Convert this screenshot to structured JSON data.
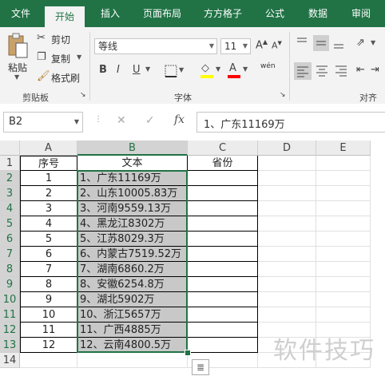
{
  "tabs": [
    "文件",
    "开始",
    "插入",
    "页面布局",
    "方方格子",
    "公式",
    "数据",
    "审阅"
  ],
  "active_tab": "开始",
  "clipboard": {
    "paste": "粘贴",
    "cut": "剪切",
    "copy": "复制",
    "format_painter": "格式刷",
    "group_label": "剪贴板"
  },
  "font": {
    "name": "等线",
    "size": "11",
    "bold": "B",
    "italic": "I",
    "underline": "U",
    "wen": "wén",
    "group_label": "字体"
  },
  "alignment": {
    "group_label": "对齐方"
  },
  "icons": {
    "cut": "scissors-icon",
    "copy": "copy-icon",
    "painter": "format-painter-icon",
    "grow": "increase-font-icon",
    "shrink": "decrease-font-icon",
    "border": "border-icon",
    "fill": "fill-color-icon",
    "fontcolor": "font-color-icon",
    "cancel": "cancel-icon",
    "enter": "check-icon",
    "fx": "function-icon"
  },
  "colors": {
    "accent": "#217346",
    "fill_yellow": "#ffff00",
    "font_red": "#ff0000"
  },
  "formula_bar": {
    "name_box": "B2",
    "fx": "fx",
    "content": "1、广东11169万"
  },
  "columns": [
    "A",
    "B",
    "C",
    "D",
    "E"
  ],
  "headers": {
    "a": "序号",
    "b": "文本",
    "c": "省份"
  },
  "rows": [
    {
      "num": "1",
      "a": "1",
      "b": "1、广东11169万"
    },
    {
      "num": "2",
      "a": "2",
      "b": "2、山东10005.83万"
    },
    {
      "num": "3",
      "a": "3",
      "b": "3、河南9559.13万"
    },
    {
      "num": "4",
      "a": "4",
      "b": "4、黑龙江8302万"
    },
    {
      "num": "5",
      "a": "5",
      "b": "5、江苏8029.3万"
    },
    {
      "num": "6",
      "a": "6",
      "b": "6、内蒙古7519.52万"
    },
    {
      "num": "7",
      "a": "7",
      "b": "7、湖南6860.2万"
    },
    {
      "num": "8",
      "a": "8",
      "b": "8、安徽6254.8万"
    },
    {
      "num": "9",
      "a": "9",
      "b": "9、湖北5902万"
    },
    {
      "num": "10",
      "a": "10",
      "b": "10、浙江5657万"
    },
    {
      "num": "11",
      "a": "11",
      "b": "11、广西4885万"
    },
    {
      "num": "12",
      "a": "12",
      "b": "12、云南4800.5万"
    }
  ],
  "watermark": "软件技巧"
}
